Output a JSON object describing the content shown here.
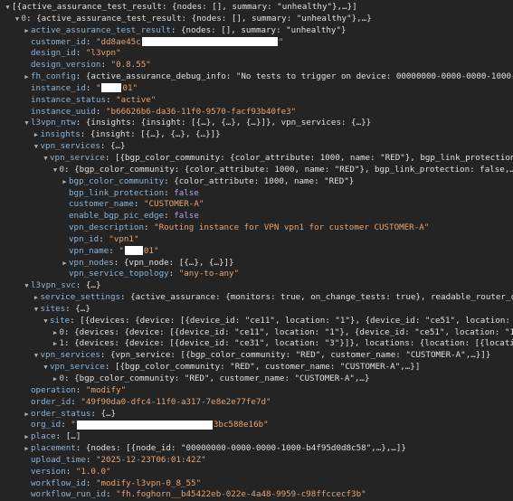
{
  "tree": [
    {
      "lvl": 0,
      "arrow": "open",
      "key": "",
      "preview": "[{active_assurance_test_result: {nodes: [], summary: \"unhealthy\"},…}]"
    },
    {
      "lvl": 1,
      "arrow": "open",
      "key": "0",
      "idx": true,
      "preview": "{active_assurance_test_result: {nodes: [], summary: \"unhealthy\"},…}"
    },
    {
      "lvl": 2,
      "arrow": "closed",
      "key": "active_assurance_test_result",
      "preview": "{nodes: [], summary: \"unhealthy\"}"
    },
    {
      "lvl": 2,
      "arrow": "none",
      "key": "customer_id",
      "type": "s",
      "value": "\"dd8ae45c",
      "redact_w": 150,
      "tail": "\""
    },
    {
      "lvl": 2,
      "arrow": "none",
      "key": "design_id",
      "type": "s",
      "value": "\"l3vpn\""
    },
    {
      "lvl": 2,
      "arrow": "none",
      "key": "design_version",
      "type": "s",
      "value": "\"0.8.55\""
    },
    {
      "lvl": 2,
      "arrow": "closed",
      "key": "fh_config",
      "preview": "{active_assurance_debug_info: \"No tests to trigger on device: 00000000-0000-0000-1000-",
      "redact_w": 78,
      "tail": "…"
    },
    {
      "lvl": 2,
      "arrow": "none",
      "key": "instance_id",
      "type": "s",
      "value": "\"",
      "redact_w": 22,
      "tail": "01\""
    },
    {
      "lvl": 2,
      "arrow": "none",
      "key": "instance_status",
      "type": "s",
      "value": "\"active\""
    },
    {
      "lvl": 2,
      "arrow": "none",
      "key": "instance_uuid",
      "type": "s",
      "value": "\"b66626b6-da36-11f0-9570-facf93b40fe3\""
    },
    {
      "lvl": 2,
      "arrow": "open",
      "key": "l3vpn_ntw",
      "preview": "{insights: {insight: [{…}, {…}, {…}]}, vpn_services: {…}}"
    },
    {
      "lvl": 3,
      "arrow": "closed",
      "key": "insights",
      "preview": "{insight: [{…}, {…}, {…}]}"
    },
    {
      "lvl": 3,
      "arrow": "open",
      "key": "vpn_services",
      "preview": "{…}"
    },
    {
      "lvl": 4,
      "arrow": "open",
      "key": "vpn_service",
      "preview": "[{bgp_color_community: {color_attribute: 1000, name: \"RED\"}, bgp_link_protection: false,…}]"
    },
    {
      "lvl": 5,
      "arrow": "open",
      "key": "0",
      "idx": true,
      "preview": "{bgp_color_community: {color_attribute: 1000, name: \"RED\"}, bgp_link_protection: false,…}"
    },
    {
      "lvl": 6,
      "arrow": "closed",
      "key": "bgp_color_community",
      "preview": "{color_attribute: 1000, name: \"RED\"}"
    },
    {
      "lvl": 6,
      "arrow": "none",
      "key": "bgp_link_protection",
      "type": "b",
      "value": "false"
    },
    {
      "lvl": 6,
      "arrow": "none",
      "key": "customer_name",
      "type": "s",
      "value": "\"CUSTOMER-A\""
    },
    {
      "lvl": 6,
      "arrow": "none",
      "key": "enable_bgp_pic_edge",
      "type": "b",
      "value": "false"
    },
    {
      "lvl": 6,
      "arrow": "none",
      "key": "vpn_description",
      "type": "s",
      "value": "\"Routing instance for VPN vpn1 for customer CUSTOMER-A\""
    },
    {
      "lvl": 6,
      "arrow": "none",
      "key": "vpn_id",
      "type": "s",
      "value": "\"vpn1\""
    },
    {
      "lvl": 6,
      "arrow": "none",
      "key": "vpn_name",
      "type": "s",
      "value": "\"",
      "redact_w": 20,
      "tail": "01\""
    },
    {
      "lvl": 6,
      "arrow": "closed",
      "key": "vpn_nodes",
      "preview": "{vpn_node: [{…}, {…}]}"
    },
    {
      "lvl": 6,
      "arrow": "none",
      "key": "vpn_service_topology",
      "type": "s",
      "value": "\"any-to-any\""
    },
    {
      "lvl": 2,
      "arrow": "open",
      "key": "l3vpn_svc",
      "preview": "{…}"
    },
    {
      "lvl": 3,
      "arrow": "closed",
      "key": "service_settings",
      "preview": "{active_assurance: {monitors: true, on_change_tests: true}, readable_router_config: true}"
    },
    {
      "lvl": 3,
      "arrow": "open",
      "key": "sites",
      "preview": "{…}"
    },
    {
      "lvl": 4,
      "arrow": "open",
      "key": "site",
      "preview": "[{devices: {device: [{device_id: \"ce11\", location: \"1\"}, {device_id: \"ce51\", location: \"1\"}]},…},…]"
    },
    {
      "lvl": 5,
      "arrow": "closed",
      "key": "0",
      "idx": true,
      "preview": "{devices: {device: [{device_id: \"ce11\", location: \"1\"}, {device_id: \"ce51\", location: \"1\"}]},…}"
    },
    {
      "lvl": 5,
      "arrow": "closed",
      "key": "1",
      "idx": true,
      "preview": "{devices: {device: [{device_id: \"ce31\", location: \"3\"}]}, locations: {location: [{location_id: \"3\"}]},…}"
    },
    {
      "lvl": 3,
      "arrow": "open",
      "key": "vpn_services",
      "preview": "{vpn_service: [{bgp_color_community: \"RED\", customer_name: \"CUSTOMER-A\",…}]}"
    },
    {
      "lvl": 4,
      "arrow": "open",
      "key": "vpn_service",
      "preview": "[{bgp_color_community: \"RED\", customer_name: \"CUSTOMER-A\",…}]"
    },
    {
      "lvl": 5,
      "arrow": "closed",
      "key": "0",
      "idx": true,
      "preview": "{bgp_color_community: \"RED\", customer_name: \"CUSTOMER-A\",…}"
    },
    {
      "lvl": 2,
      "arrow": "none",
      "key": "operation",
      "type": "s",
      "value": "\"modify\""
    },
    {
      "lvl": 2,
      "arrow": "none",
      "key": "order_id",
      "type": "s",
      "value": "\"49f90da0-dfc4-11f0-a317-7e8e2e77fe7d\""
    },
    {
      "lvl": 2,
      "arrow": "closed",
      "key": "order_status",
      "preview": "{…}"
    },
    {
      "lvl": 2,
      "arrow": "none",
      "key": "org_id",
      "type": "s",
      "value": "\"",
      "redact_w": 150,
      "tail": "3bc588e16b\""
    },
    {
      "lvl": 2,
      "arrow": "closed",
      "key": "place",
      "preview": "[…]"
    },
    {
      "lvl": 2,
      "arrow": "closed",
      "key": "placement",
      "preview": "{nodes: [{node_id: \"00000000-0000-0000-1000-b4f95d0d8c58\",…},…]}"
    },
    {
      "lvl": 2,
      "arrow": "none",
      "key": "upload_time",
      "type": "s",
      "value": "\"2025-12-23T06:01:42Z\""
    },
    {
      "lvl": 2,
      "arrow": "none",
      "key": "version",
      "type": "s",
      "value": "\"1.0.0\""
    },
    {
      "lvl": 2,
      "arrow": "none",
      "key": "workflow_id",
      "type": "s",
      "value": "\"modify-l3vpn-0_8_55\""
    },
    {
      "lvl": 2,
      "arrow": "none",
      "key": "workflow_run_id",
      "type": "s",
      "value": "\"fh.foghorn__b45422eb-022e-4a48-9959-c98ffccecf3b\""
    }
  ]
}
